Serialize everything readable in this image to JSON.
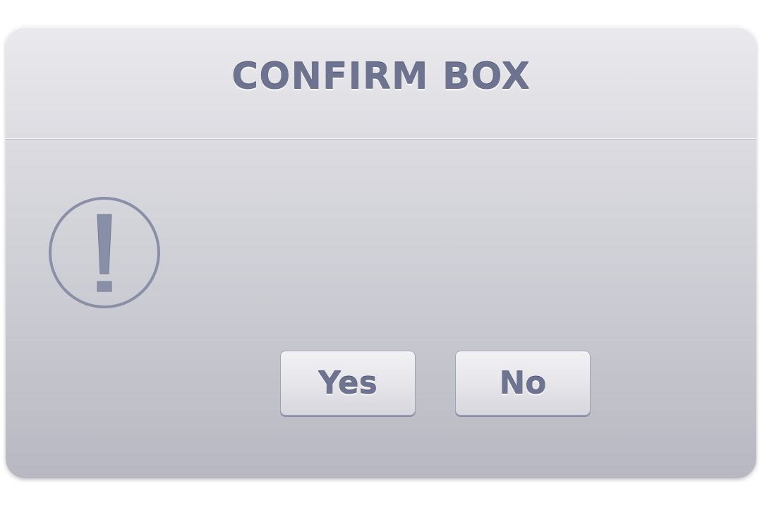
{
  "dialog": {
    "title": "CONFIRM BOX",
    "message": "",
    "icon": "exclamation-circle-icon",
    "buttons": {
      "yes_label": "Yes",
      "no_label": "No"
    }
  },
  "colors": {
    "accent_text": "#6e7390",
    "icon_stroke": "#8a8fa8",
    "dialog_top": "#eaeaee",
    "dialog_bottom": "#b8b8c2"
  }
}
